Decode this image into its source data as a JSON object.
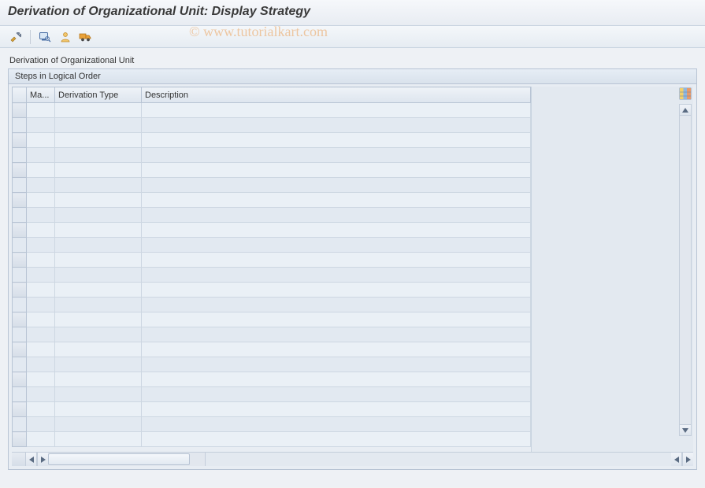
{
  "header": {
    "title": "Derivation of Organizational Unit: Display Strategy"
  },
  "watermark": "© www.tutorialkart.com",
  "toolbar": {
    "icons": {
      "display_change": "display-change-icon",
      "overview": "overview-icon",
      "customizing": "customizing-icon",
      "transport": "transport-icon"
    }
  },
  "section": {
    "title": "Derivation of Organizational Unit"
  },
  "grid": {
    "group_title": "Steps in Logical Order",
    "columns": {
      "maintain": "Ma...",
      "derivation_type": "Derivation Type",
      "description": "Description"
    },
    "row_count": 23
  }
}
